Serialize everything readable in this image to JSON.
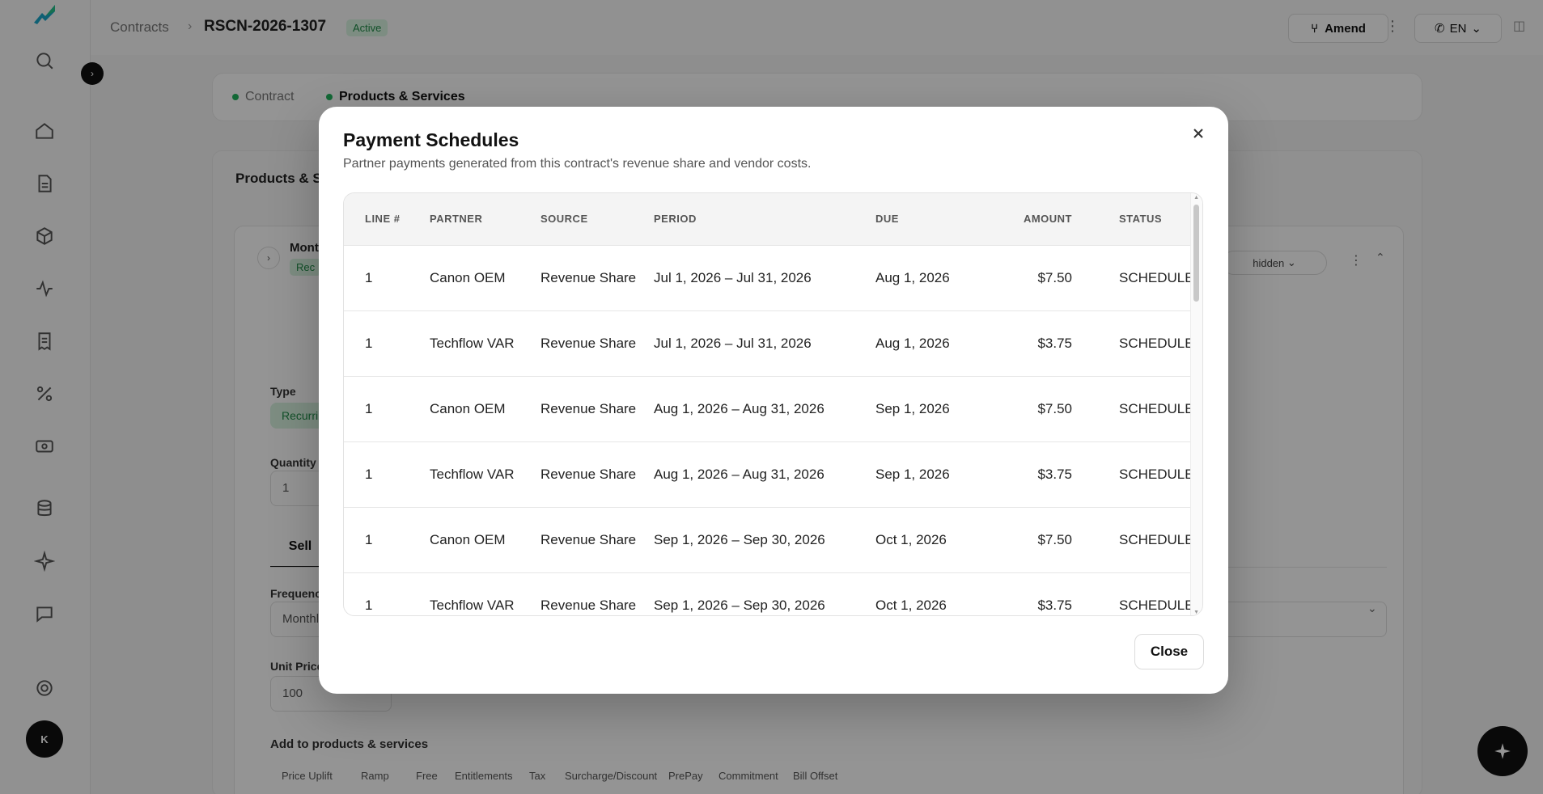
{
  "background": {
    "breadcrumb": {
      "root": "Contracts",
      "separator": "›",
      "contract_id": "RSCN-2026-1307",
      "status": "Active"
    },
    "header": {
      "amend_label": "Amend",
      "language": "EN"
    },
    "tabs": [
      {
        "label": "Contract"
      },
      {
        "label": "Products & Services"
      }
    ],
    "section_title": "Products & S",
    "product": {
      "name": "Mont",
      "badge": "Rec",
      "hidden_label": "hidden",
      "type_label": "Type",
      "type_value": "Recurrin",
      "quantity_label": "Quantity",
      "quantity_value": "1",
      "sell_tab": "Sell",
      "frequency_label": "Frequency",
      "frequency_value": "Monthly",
      "unit_price_label": "Unit Price",
      "unit_price_value": "100",
      "add_title": "Add to products & services",
      "chips": [
        "Price Uplift",
        "Ramp",
        "Free",
        "Entitlements",
        "Tax",
        "Surcharge/Discount",
        "PrePay",
        "Commitment",
        "Bill Offset"
      ]
    },
    "avatar_initial": "K"
  },
  "modal": {
    "title": "Payment Schedules",
    "subtitle": "Partner payments generated from this contract's revenue share and vendor costs.",
    "columns": [
      "LINE #",
      "PARTNER",
      "SOURCE",
      "PERIOD",
      "DUE",
      "AMOUNT",
      "STATUS"
    ],
    "rows": [
      {
        "line": "1",
        "partner": "Canon OEM",
        "source": "Revenue Share",
        "period": "Jul 1, 2026 – Jul 31, 2026",
        "due": "Aug 1, 2026",
        "amount": "$7.50",
        "status": "SCHEDULED"
      },
      {
        "line": "1",
        "partner": "Techflow VAR",
        "source": "Revenue Share",
        "period": "Jul 1, 2026 – Jul 31, 2026",
        "due": "Aug 1, 2026",
        "amount": "$3.75",
        "status": "SCHEDULED"
      },
      {
        "line": "1",
        "partner": "Canon OEM",
        "source": "Revenue Share",
        "period": "Aug 1, 2026 – Aug 31, 2026",
        "due": "Sep 1, 2026",
        "amount": "$7.50",
        "status": "SCHEDULED"
      },
      {
        "line": "1",
        "partner": "Techflow VAR",
        "source": "Revenue Share",
        "period": "Aug 1, 2026 – Aug 31, 2026",
        "due": "Sep 1, 2026",
        "amount": "$3.75",
        "status": "SCHEDULED"
      },
      {
        "line": "1",
        "partner": "Canon OEM",
        "source": "Revenue Share",
        "period": "Sep 1, 2026 – Sep 30, 2026",
        "due": "Oct 1, 2026",
        "amount": "$7.50",
        "status": "SCHEDULED"
      },
      {
        "line": "1",
        "partner": "Techflow VAR",
        "source": "Revenue Share",
        "period": "Sep 1, 2026 – Sep 30, 2026",
        "due": "Oct 1, 2026",
        "amount": "$3.75",
        "status": "SCHEDULED"
      }
    ],
    "close_label": "Close"
  },
  "colors": {
    "accent_green": "#22b35e",
    "status_bg": "#d7f3e0",
    "overlay": "rgba(0,0,0,0.42)"
  },
  "icons": [
    "logo-icon",
    "search-icon",
    "home-icon",
    "document-icon",
    "cube-icon",
    "activity-icon",
    "receipt-icon",
    "percent-icon",
    "cash-icon",
    "database-icon",
    "sparkle-icon",
    "chat-icon",
    "settings-icon",
    "close-icon",
    "chevron-down-icon",
    "kebab-icon",
    "sparkle-fab-icon"
  ]
}
